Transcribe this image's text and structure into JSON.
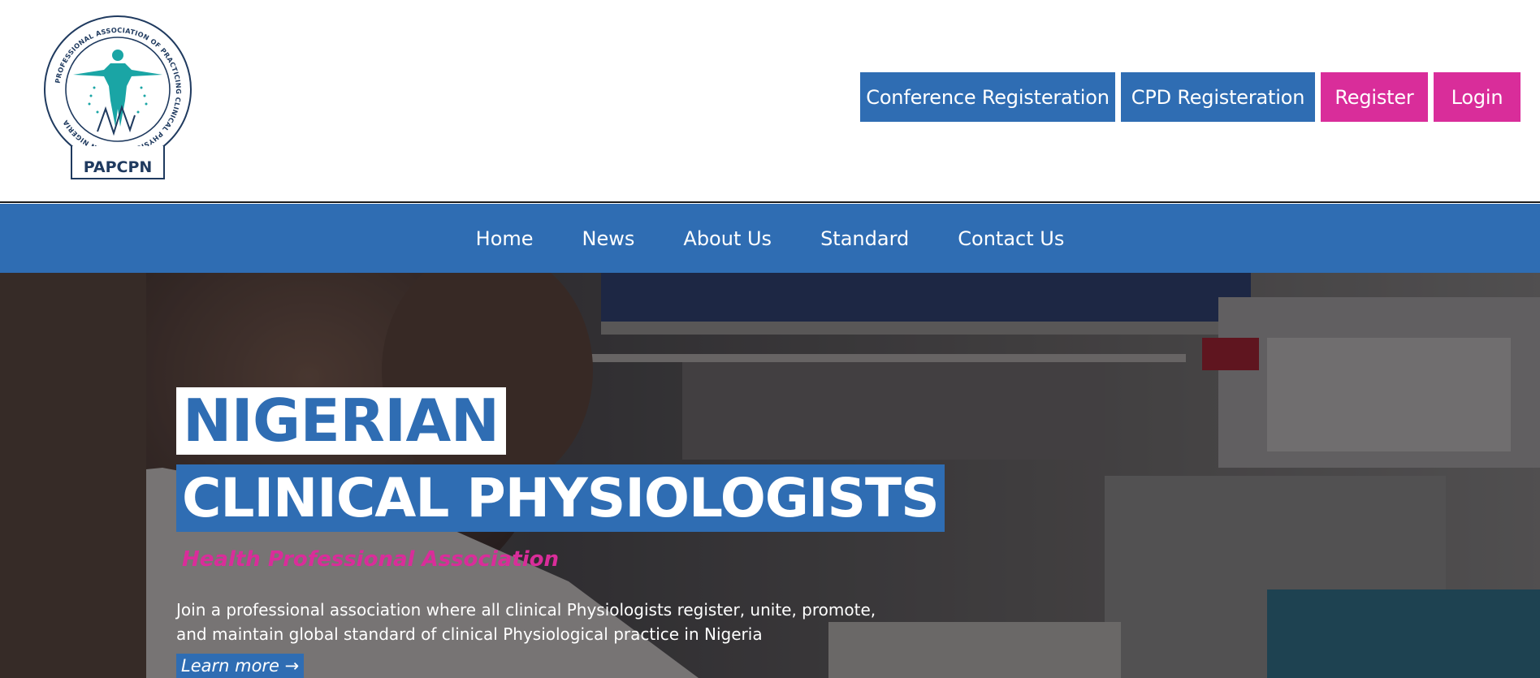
{
  "logo": {
    "ring_text": "PROFESSIONAL ASSOCIATION OF PRACTICING CLINICAL PHYSIOLOGISTS IN NIGERIA",
    "label": "PAPCPN",
    "color_primary": "#1f3a5f",
    "color_accent": "#1aa5a5"
  },
  "header": {
    "actions": [
      {
        "label": "Conference Registeration",
        "color": "#2f6db3"
      },
      {
        "label": "CPD Registeration",
        "color": "#2f6db3"
      },
      {
        "label": "Register",
        "color": "#d92d9a"
      },
      {
        "label": "Login",
        "color": "#d92d9a"
      }
    ]
  },
  "nav": {
    "items": [
      "Home",
      "News",
      "About Us",
      "Standard",
      "Contact Us"
    ]
  },
  "hero": {
    "title_line1": "NIGERIAN",
    "title_line2": "CLINICAL PHYSIOLOGISTS",
    "subtitle": "Health Professional Association",
    "description": "Join a professional association where all clinical Physiologists register, unite, promote, and maintain global standard of clinical Physiological practice in Nigeria",
    "cta_label": "Learn more →"
  },
  "colors": {
    "brand_blue": "#2f6db3",
    "brand_pink": "#d92d9a"
  }
}
